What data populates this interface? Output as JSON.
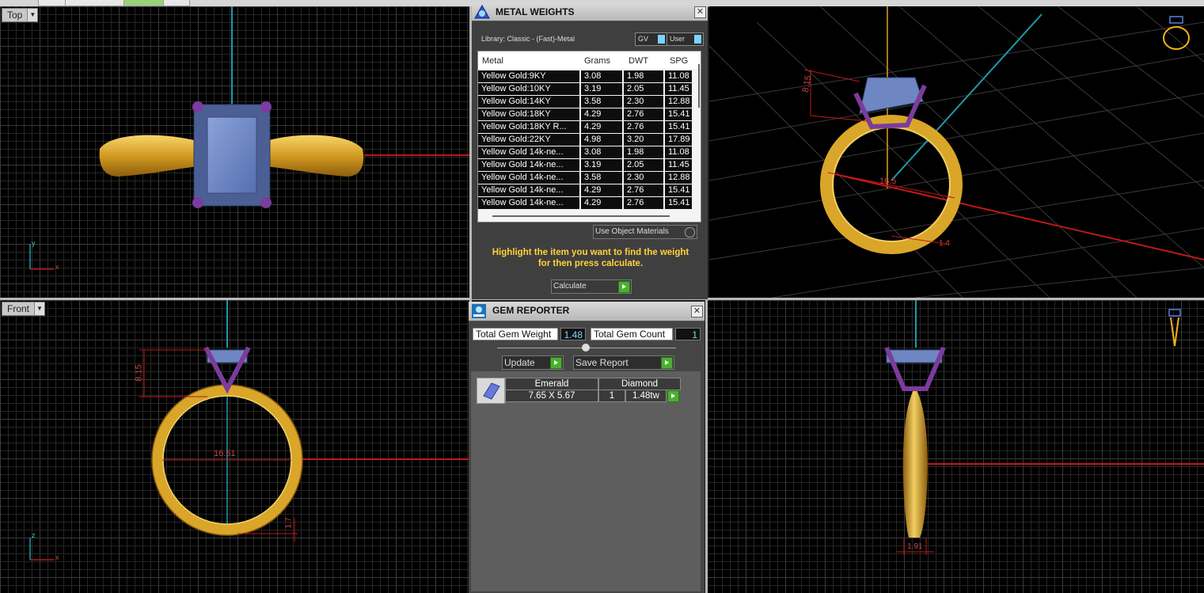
{
  "app": {
    "accent_color": "#4caf2e",
    "ring_gold": "#d9a62a",
    "gem_blue": "#6e86c2",
    "prong_purple": "#7b3c9c",
    "dimension_red": "#cc2222"
  },
  "viewports": {
    "top": {
      "label": "Top",
      "axis_y": "y",
      "axis_x": "x"
    },
    "front": {
      "label": "Front",
      "axis_y": "z",
      "axis_x": "x",
      "dim_height": "8.15",
      "dim_width": "16.51",
      "dim_shank": "1.7"
    },
    "perspective": {
      "dim_height": "8.15",
      "dim_inner": "16.5",
      "dim_shank": "1.4"
    },
    "right": {
      "dim_shank": "1.91"
    }
  },
  "metal_weights": {
    "title": "METAL WEIGHTS",
    "library_label": "Library: Classic - (Fast)-Metal",
    "gv_label": "GV",
    "user_label": "User",
    "columns": [
      "Metal",
      "Grams",
      "DWT",
      "SPG"
    ],
    "rows": [
      {
        "metal": "Yellow Gold:9KY",
        "grams": "3.08",
        "dwt": "1.98",
        "spg": "11.08"
      },
      {
        "metal": "Yellow Gold:10KY",
        "grams": "3.19",
        "dwt": "2.05",
        "spg": "11.45"
      },
      {
        "metal": "Yellow Gold:14KY",
        "grams": "3.58",
        "dwt": "2.30",
        "spg": "12.88"
      },
      {
        "metal": "Yellow Gold:18KY",
        "grams": "4.29",
        "dwt": "2.76",
        "spg": "15.41"
      },
      {
        "metal": "Yellow Gold:18KY R...",
        "grams": "4.29",
        "dwt": "2.76",
        "spg": "15.41"
      },
      {
        "metal": "Yellow Gold:22KY",
        "grams": "4.98",
        "dwt": "3.20",
        "spg": "17.89"
      },
      {
        "metal": "Yellow Gold 14k-ne...",
        "grams": "3.08",
        "dwt": "1.98",
        "spg": "11.08"
      },
      {
        "metal": "Yellow Gold 14k-ne...",
        "grams": "3.19",
        "dwt": "2.05",
        "spg": "11.45"
      },
      {
        "metal": "Yellow Gold 14k-ne...",
        "grams": "3.58",
        "dwt": "2.30",
        "spg": "12.88"
      },
      {
        "metal": "Yellow Gold 14k-ne...",
        "grams": "4.29",
        "dwt": "2.76",
        "spg": "15.41"
      },
      {
        "metal": "Yellow Gold 14k-ne...",
        "grams": "4.29",
        "dwt": "2.76",
        "spg": "15.41"
      }
    ],
    "use_object_materials": "Use Object Materials",
    "hint_line1": "Highlight the item you want to find the weight",
    "hint_line2": "for then press calculate.",
    "calculate_label": "Calculate"
  },
  "gem_reporter": {
    "title": "GEM REPORTER",
    "total_weight_label": "Total Gem Weight",
    "total_weight_value": "1.48",
    "total_count_label": "Total Gem Count",
    "total_count_value": "1",
    "update_label": "Update",
    "save_report_label": "Save Report",
    "gem": {
      "cut": "Emerald",
      "size": "7.65 X 5.67",
      "material": "Diamond",
      "count": "1",
      "weight": "1.48tw"
    }
  }
}
